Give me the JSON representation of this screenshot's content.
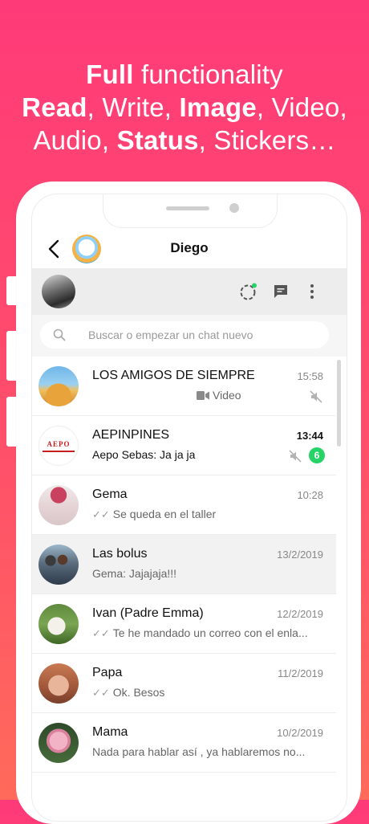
{
  "promo": {
    "line1_bold": "Full",
    "line1_rest": " functionality",
    "line2": [
      "Read",
      ", Write, ",
      "Image",
      ", Video,"
    ],
    "line3": [
      "Audio, ",
      "Status",
      ", Stickers…"
    ]
  },
  "topbar": {
    "title": "Diego",
    "back_icon": "chevron-left-icon",
    "bot_icon": "astronaut-avatar-icon"
  },
  "header": {
    "status_icon": "status-ring-icon",
    "new_chat_icon": "chat-icon",
    "menu_icon": "more-vertical-icon"
  },
  "search": {
    "placeholder": "Buscar o empezar un chat nuevo"
  },
  "chats": [
    {
      "name": "LOS AMIGOS DE SIEMPRE",
      "time": "15:58",
      "preview": "Video",
      "muted": true
    },
    {
      "name": "AEPINPINES",
      "time": "13:44",
      "preview": "Aepo Sebas: Ja ja ja",
      "muted": true,
      "unread": "6",
      "avatar_text": "AEPO"
    },
    {
      "name": "Gema",
      "time": "10:28",
      "preview": "Se queda en el taller",
      "ticks": "✓✓"
    },
    {
      "name": "Las bolus",
      "time": "13/2/2019",
      "preview": "Gema: Jajajaja!!!"
    },
    {
      "name": "Ivan (Padre Emma)",
      "time": "12/2/2019",
      "preview": "Te he mandado un correo con el enla...",
      "ticks": "✓✓"
    },
    {
      "name": "Papa",
      "time": "11/2/2019",
      "preview": "Ok. Besos",
      "ticks": "✓✓"
    },
    {
      "name": "Mama",
      "time": "10/2/2019",
      "preview": "Nada para hablar así , ya hablaremos no..."
    }
  ],
  "colors": {
    "accent": "#25d366",
    "background_top": "#ff3a78",
    "background_bottom": "#ff6a5a"
  }
}
